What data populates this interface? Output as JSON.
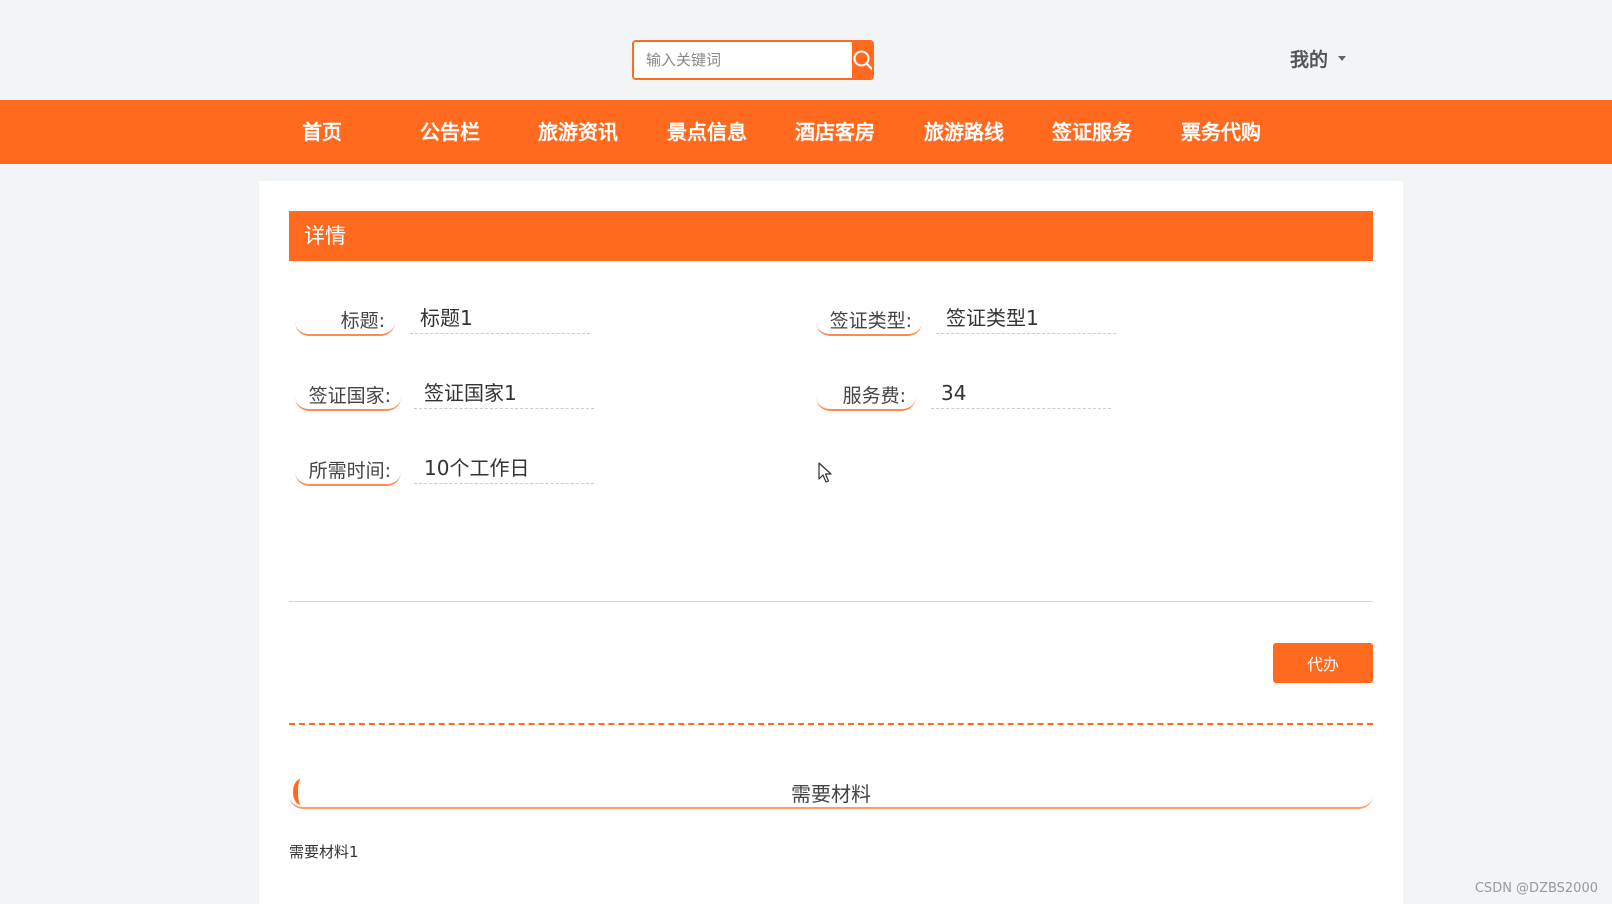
{
  "header": {
    "search": {
      "placeholder": "输入关键词",
      "value": ""
    },
    "user_menu_label": "我的"
  },
  "nav": {
    "items": [
      {
        "label": "首页"
      },
      {
        "label": "公告栏"
      },
      {
        "label": "旅游资讯"
      },
      {
        "label": "景点信息"
      },
      {
        "label": "酒店客房"
      },
      {
        "label": "旅游路线"
      },
      {
        "label": "签证服务"
      },
      {
        "label": "票务代购"
      }
    ]
  },
  "detail": {
    "header_title": "详情",
    "fields": {
      "title": {
        "label": "标题:",
        "value": "标题1"
      },
      "visa_type": {
        "label": "签证类型:",
        "value": "签证类型1"
      },
      "visa_country": {
        "label": "签证国家:",
        "value": "签证国家1"
      },
      "service_fee": {
        "label": "服务费:",
        "value": "34"
      },
      "required_time": {
        "label": "所需时间:",
        "value": "10个工作日"
      }
    },
    "action_button_label": "代办",
    "materials": {
      "title": "需要材料",
      "content": "需要材料1"
    }
  },
  "watermark": "CSDN @DZBS2000",
  "colors": {
    "accent": "#ff6a1f",
    "background": "#f2f5f7",
    "panel": "#ffffff"
  }
}
